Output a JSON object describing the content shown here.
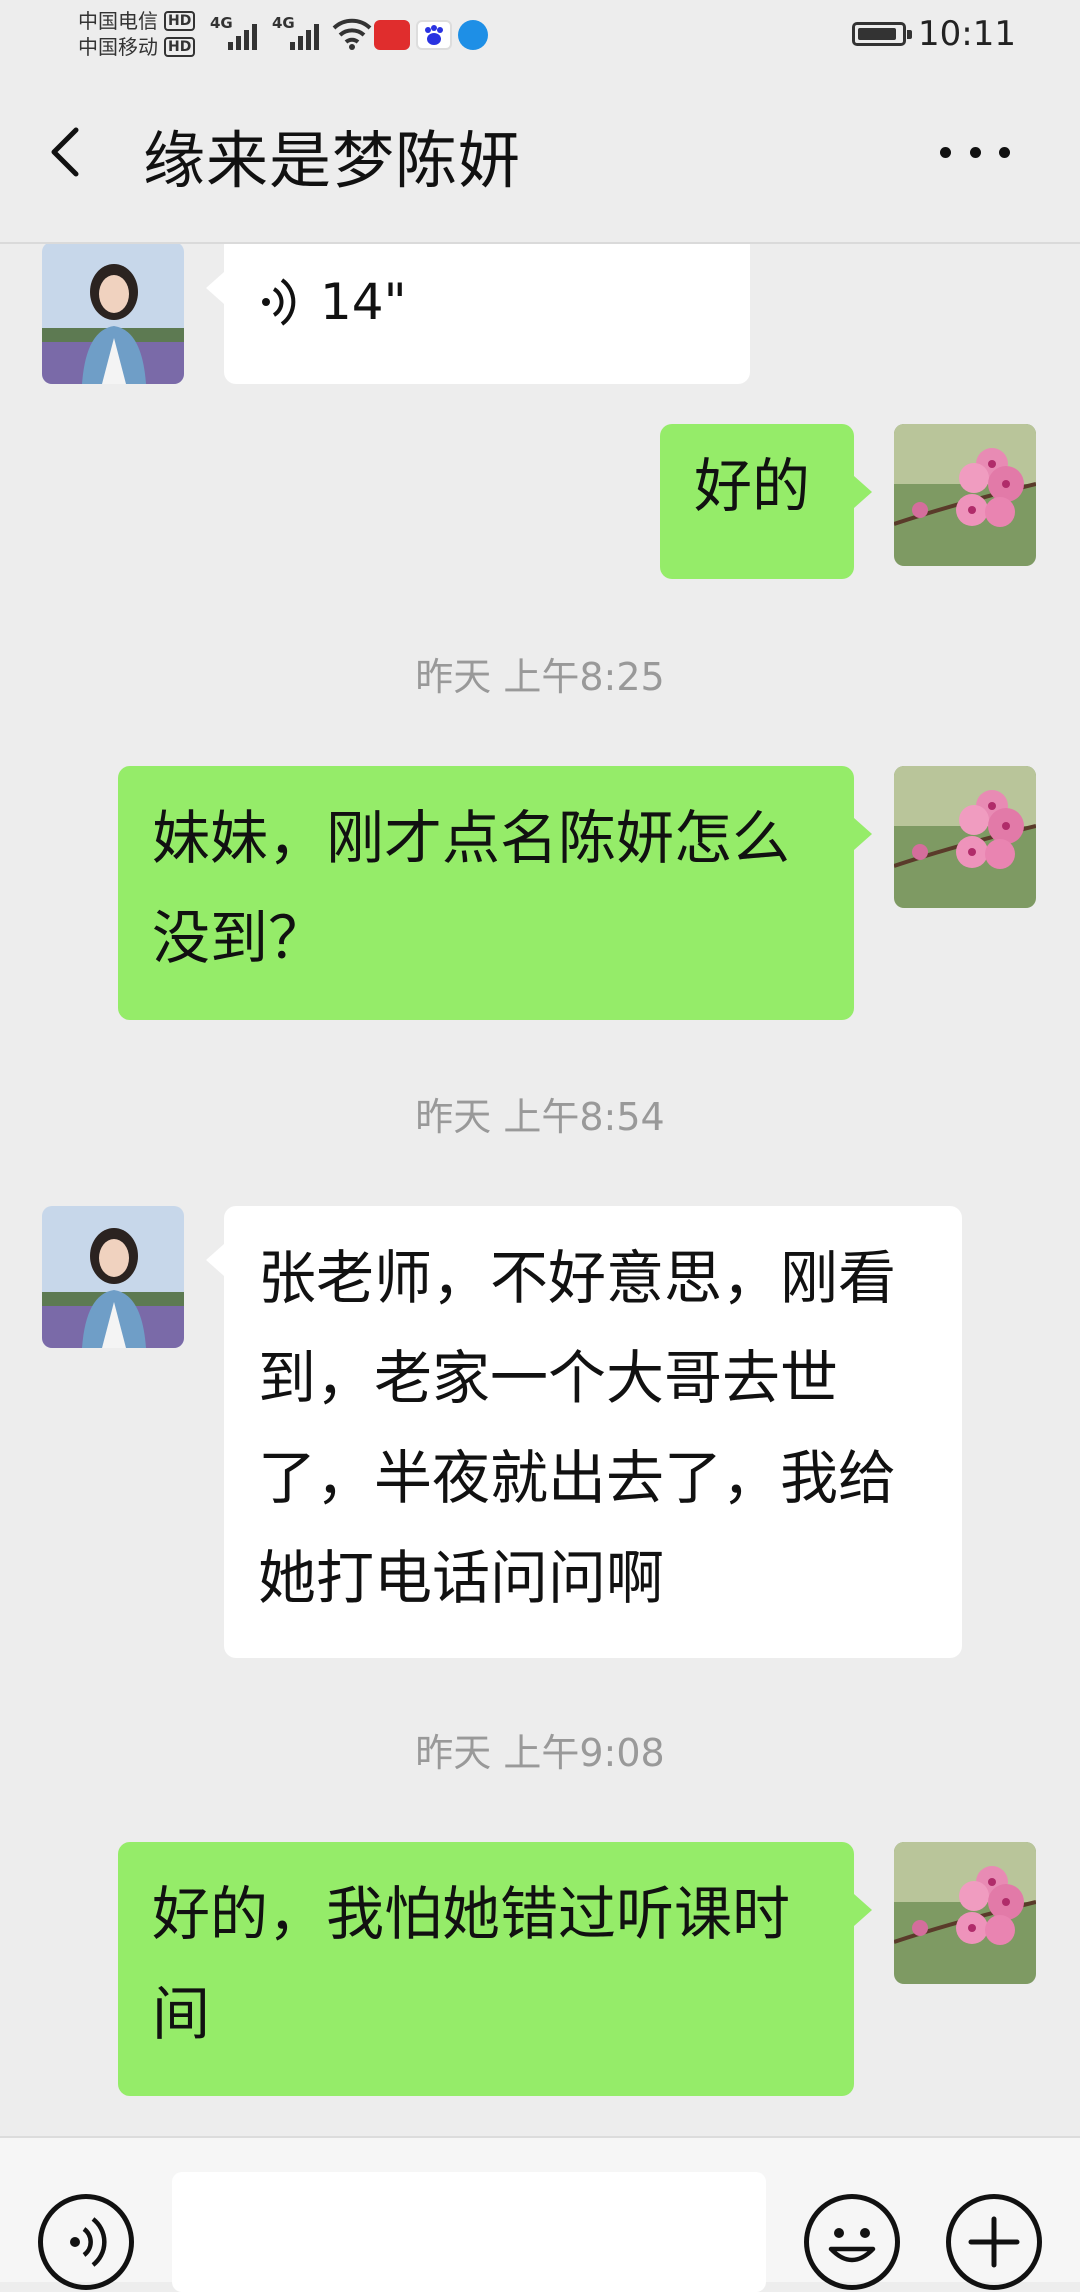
{
  "status_bar": {
    "carrier_1": "中国电信",
    "carrier_2": "中国移动",
    "hd": "HD",
    "network": "4G",
    "time": "10:11",
    "battery_level": 0.9,
    "app_icons": [
      "toutiao-icon",
      "baidu-icon",
      "browser-icon"
    ],
    "colors": {
      "toutiao": "#e02d2d",
      "baidu": "#2932e1",
      "browser": "#1e8fe6"
    }
  },
  "header": {
    "title": "缘来是梦陈妍",
    "back_icon": "chevron-left-icon",
    "more_icon": "more-dots-icon"
  },
  "messages": [
    {
      "type": "voice",
      "side": "in",
      "duration": "14\""
    },
    {
      "type": "text",
      "side": "out",
      "text": "好的"
    },
    {
      "type": "time",
      "text": "昨天 上午8:25"
    },
    {
      "type": "text",
      "side": "out",
      "text": "妹妹，刚才点名陈妍怎么没到？"
    },
    {
      "type": "time",
      "text": "昨天 上午8:54"
    },
    {
      "type": "text",
      "side": "in",
      "text": "张老师，不好意思，刚看到，老家一个大哥去世了，半夜就出去了，我给她打电话问问啊"
    },
    {
      "type": "time",
      "text": "昨天 上午9:08"
    },
    {
      "type": "text",
      "side": "out",
      "text": "好的，我怕她错过听课时间"
    }
  ],
  "bottom_bar": {
    "voice_icon": "voice-input-icon",
    "emoji_icon": "emoji-icon",
    "plus_icon": "plus-icon"
  },
  "colors": {
    "background": "#ededed",
    "outgoing_bubble": "#95ec69",
    "incoming_bubble": "#ffffff",
    "timestamp": "#999999"
  }
}
